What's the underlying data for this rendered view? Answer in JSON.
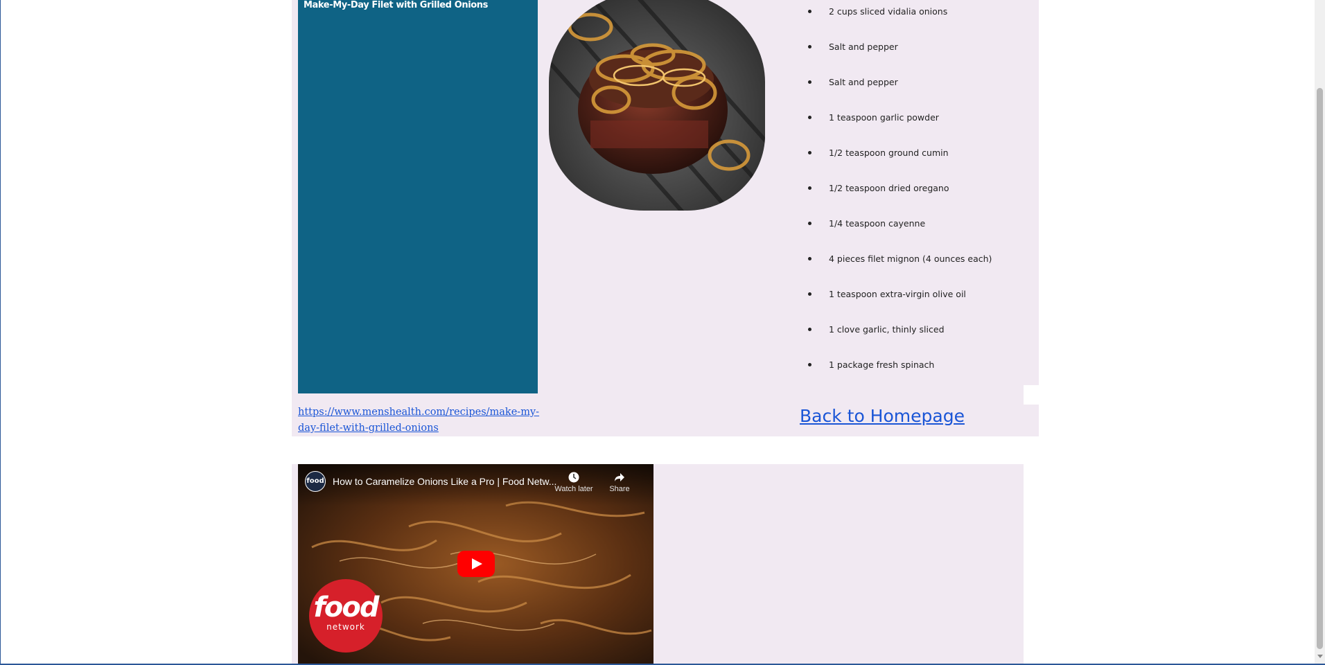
{
  "recipe": {
    "title": "Make-My-Day Filet with Grilled Onions",
    "photo_icon": "steak-with-onions-photo",
    "ingredients": [
      "2 cups sliced vidalia onions",
      "Salt and pepper",
      "Salt and pepper",
      "1 teaspoon garlic powder",
      "1/2 teaspoon ground cumin",
      "1/2 teaspoon dried oregano",
      "1/4 teaspoon cayenne",
      "4 pieces filet mignon (4 ounces each)",
      "1 teaspoon extra-virgin olive oil",
      "1 clove garlic, thinly sliced",
      "1 package fresh spinach"
    ],
    "source_link": "https://www.menshealth.com/recipes/make-my-day-filet-with-grilled-onions",
    "home_link": "Back to Homepage"
  },
  "video": {
    "title": "How to Caramelize Onions Like a Pro | Food Netw...",
    "channel_initials": "food",
    "watch_later": "Watch later",
    "share": "Share",
    "brand_big": "food",
    "brand_small": "network"
  },
  "colors": {
    "title_panel": "#0f6385",
    "section_bg": "#f1e9f2",
    "link": "#1a55d6"
  }
}
